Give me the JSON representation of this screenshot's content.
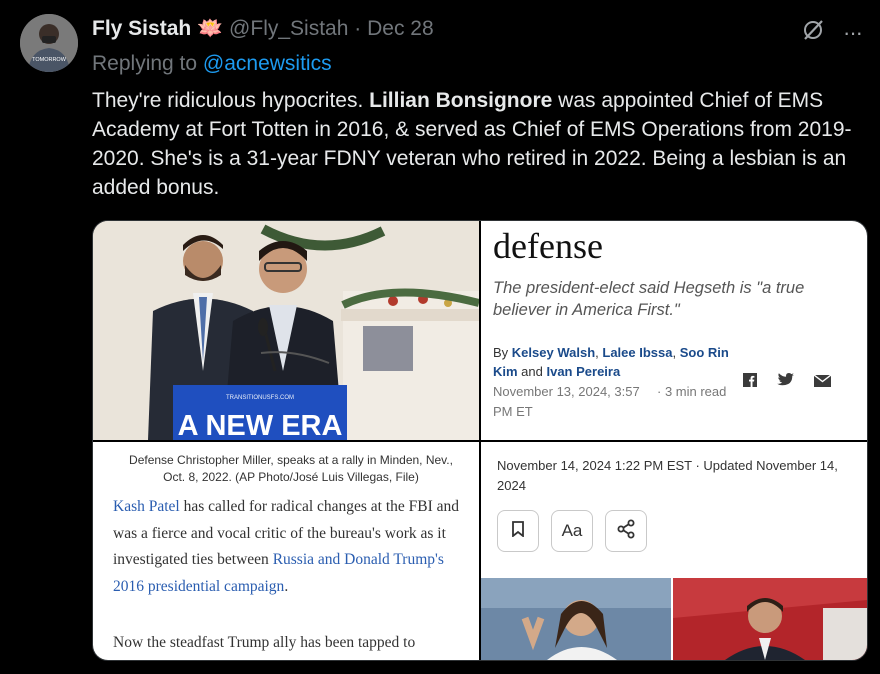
{
  "tweet": {
    "display_name": "Fly Sistah",
    "emoji": "🪷",
    "handle": "@Fly_Sistah",
    "separator": "·",
    "date": "Dec 28",
    "replying_prefix": "Replying to",
    "replying_to": "@acnewsitics",
    "text_before": "They're ridiculous hypocrites. ",
    "text_bold": "Lillian Bonsignore",
    "text_after": " was appointed Chief of EMS Academy at Fort Totten in 2016, & served as Chief of EMS Operations from 2019-2020. She's is a 31-year FDNY veteran who retired in 2022. Being a lesbian is an added bonus.",
    "more_label": "···",
    "avatar_text": "TOMORROW"
  },
  "media": {
    "panel1": {
      "sign_small": "TRANSITIONUSFS.COM",
      "sign_text": "A NEW ERA"
    },
    "panel2": {
      "heading": "defense",
      "dek": "The president-elect said Hegseth is \"a true believer in America First.\"",
      "by": "By",
      "author1": "Kelsey Walsh",
      "sep1": ", ",
      "author2": "Lalee Ibssa",
      "sep2": ", ",
      "author3": "Soo Rin Kim",
      "and": " and ",
      "author4": "Ivan Pereira",
      "date": "November 13, 2024, 3:57 PM ET",
      "read_time": "· 3 min read"
    },
    "panel3": {
      "caption": "Defense Christopher Miller, speaks at a rally in Minden, Nev., Oct. 8, 2022. (AP Photo/José Luis Villegas, File)",
      "link1": "Kash Patel",
      "text1": " has called for radical changes at the FBI and was a fierce and vocal critic of the bureau's work as it investigated ties between ",
      "link2": "Russia and Donald Trump's 2016 presidential campaign",
      "text2": ".",
      "para2": "Now the steadfast Trump ally has been tapped to"
    },
    "panel4": {
      "updated": "November 14, 2024 1:22 PM EST · Updated November 14, 2024",
      "font_btn": "Aa"
    }
  },
  "colors": {
    "link": "#1d9bf0",
    "muted": "#71767b",
    "text": "#e7e9ea",
    "sign": "#1f4fbf"
  }
}
